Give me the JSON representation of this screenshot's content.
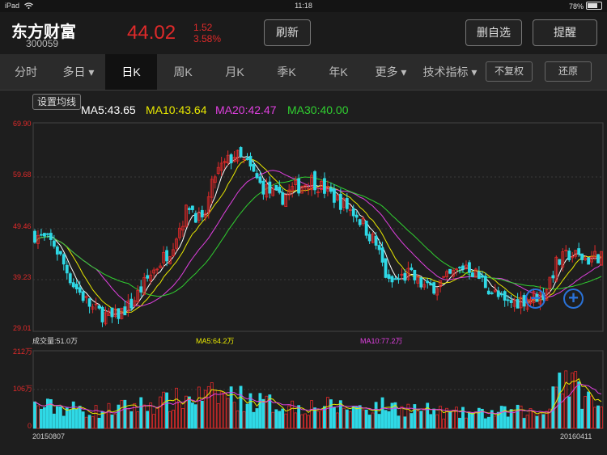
{
  "status": {
    "device": "iPad",
    "time": "11:18",
    "battery": "78%"
  },
  "header": {
    "name": "东方财富",
    "code": "300059",
    "price": "44.02",
    "change": "1.52",
    "change_pct": "3.58%",
    "refresh_label": "刷新",
    "remove_fav_label": "删自选",
    "alert_label": "提醒"
  },
  "tabs": [
    {
      "label": "分时"
    },
    {
      "label": "多日 ▾"
    },
    {
      "label": "日K"
    },
    {
      "label": "周K"
    },
    {
      "label": "月K"
    },
    {
      "label": "季K"
    },
    {
      "label": "年K"
    },
    {
      "label": "更多 ▾"
    },
    {
      "label": "技术指标 ▾"
    }
  ],
  "buttons": {
    "no_adjust": "不复权",
    "restore": "还原",
    "set_ma": "设置均线"
  },
  "ma_labels": {
    "ma5": "MA5:43.65",
    "ma10": "MA10:43.64",
    "ma20": "MA20:42.47",
    "ma30": "MA30:40.00"
  },
  "price_axis": [
    "69.90",
    "59.68",
    "49.46",
    "39.23",
    "29.01"
  ],
  "volume_labels": {
    "vol": "成交量:51.0万",
    "ma5": "MA5:64.2万",
    "ma10": "MA10:77.2万"
  },
  "volume_axis": [
    "212万",
    "106万",
    "0"
  ],
  "dates": {
    "start": "20150807",
    "end": "20160411"
  },
  "colors": {
    "up": "#e02a2a",
    "down": "#2fd9e6",
    "ma5": "#ffffff",
    "ma10": "#e8e800",
    "ma20": "#e040e0",
    "ma30": "#30d030"
  },
  "icons": {
    "zoom_out": "zoom-out-icon",
    "zoom_in": "zoom-in-icon",
    "wifi": "wifi-icon",
    "battery": "battery-icon"
  },
  "chart_data": {
    "type": "candlestick",
    "ylim": [
      29.01,
      69.9
    ],
    "volume_ylim": [
      0,
      212
    ],
    "anchors": [
      [
        0,
        48
      ],
      [
        6,
        46
      ],
      [
        12,
        38
      ],
      [
        18,
        33
      ],
      [
        24,
        31
      ],
      [
        30,
        34
      ],
      [
        36,
        40
      ],
      [
        42,
        45
      ],
      [
        48,
        54
      ],
      [
        52,
        50
      ],
      [
        56,
        60
      ],
      [
        62,
        64
      ],
      [
        66,
        62
      ],
      [
        70,
        58
      ],
      [
        76,
        55
      ],
      [
        80,
        57
      ],
      [
        86,
        59
      ],
      [
        92,
        56
      ],
      [
        100,
        52
      ],
      [
        106,
        46
      ],
      [
        110,
        38
      ],
      [
        116,
        40
      ],
      [
        122,
        37
      ],
      [
        128,
        39
      ],
      [
        134,
        42
      ],
      [
        140,
        38
      ],
      [
        146,
        34
      ],
      [
        152,
        35
      ],
      [
        158,
        36
      ],
      [
        162,
        42
      ],
      [
        166,
        44
      ],
      [
        172,
        43
      ],
      [
        176,
        44
      ]
    ],
    "volume_anchors": [
      [
        0,
        60
      ],
      [
        10,
        55
      ],
      [
        20,
        45
      ],
      [
        30,
        60
      ],
      [
        40,
        70
      ],
      [
        50,
        85
      ],
      [
        60,
        90
      ],
      [
        70,
        70
      ],
      [
        80,
        60
      ],
      [
        90,
        60
      ],
      [
        100,
        55
      ],
      [
        110,
        60
      ],
      [
        120,
        50
      ],
      [
        130,
        40
      ],
      [
        140,
        40
      ],
      [
        150,
        45
      ],
      [
        158,
        40
      ],
      [
        163,
        150
      ],
      [
        168,
        110
      ],
      [
        176,
        50
      ]
    ]
  }
}
